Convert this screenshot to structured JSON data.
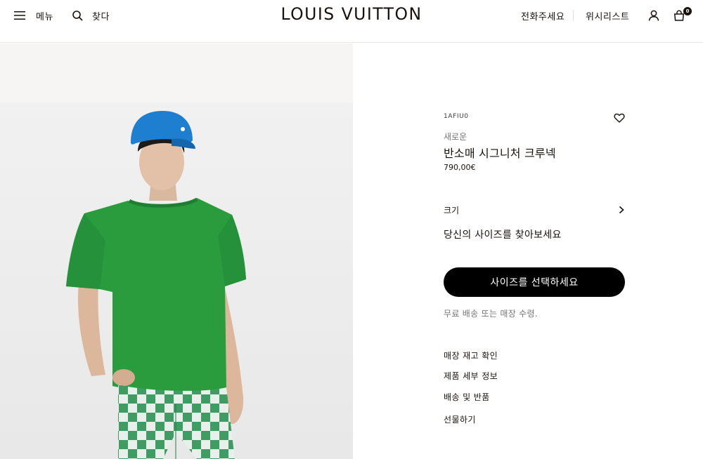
{
  "header": {
    "menu_label": "메뉴",
    "search_label": "찾다",
    "logo": "LOUIS VUITTON",
    "call_label": "전화주세요",
    "wishlist_label": "위시리스트",
    "cart_count": "0"
  },
  "product": {
    "sku": "1AFIU0",
    "tag": "새로운",
    "title": "반소매 시그니처 크루넥",
    "price": "790,00€",
    "size_label": "크기",
    "size_guide": "당신의 사이즈를 찾아보세요",
    "cta_label": "사이즈를 선택하세요",
    "delivery_note": "무료 배송 또는 매장 수령."
  },
  "links": [
    "매장 재고 확인",
    "제품 세부 정보",
    "배송 및 반품",
    "선물하기"
  ],
  "icons": {
    "menu": "hamburger-icon",
    "search": "search-icon",
    "account": "user-icon",
    "bag": "bag-icon",
    "wishlist": "heart-icon",
    "size_chevron": "chevron-right-icon"
  },
  "colors": {
    "cta_background": "#000000",
    "shirt_green": "#2a9c3e",
    "cap_blue": "#1e7fd0"
  }
}
